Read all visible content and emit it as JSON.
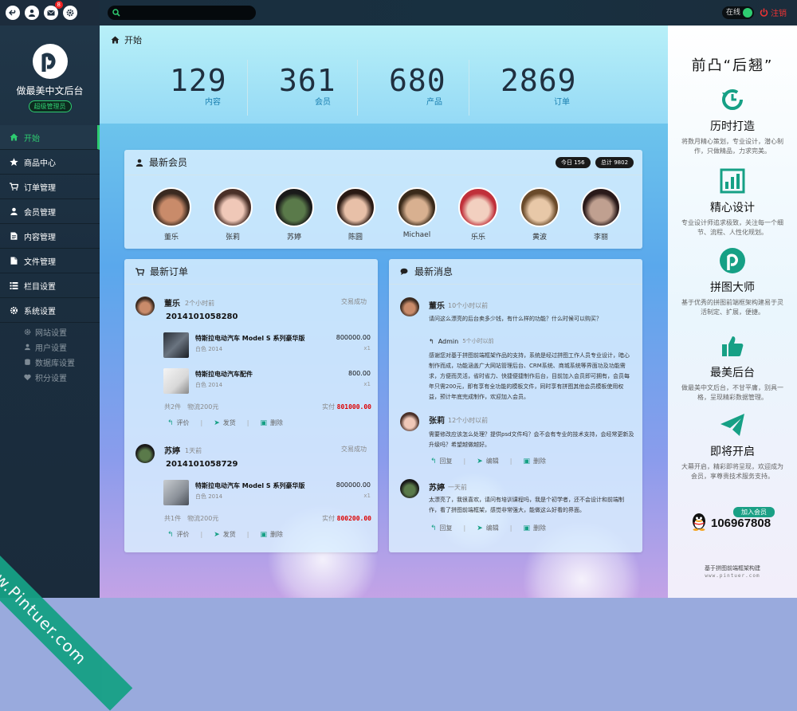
{
  "topbar": {
    "badge_count": "8",
    "online_label": "在线",
    "logout_label": "注销",
    "search": {
      "placeholder": "",
      "value": ""
    }
  },
  "sidebar": {
    "brand_title": "做最美中文后台",
    "brand_role": "超级管理员",
    "items": [
      {
        "label": "开始",
        "icon": "home-icon"
      },
      {
        "label": "商品中心",
        "icon": "star-icon"
      },
      {
        "label": "订单管理",
        "icon": "cart-icon"
      },
      {
        "label": "会员管理",
        "icon": "user-icon"
      },
      {
        "label": "内容管理",
        "icon": "file-text-icon"
      },
      {
        "label": "文件管理",
        "icon": "file-icon"
      },
      {
        "label": "栏目设置",
        "icon": "list-icon"
      },
      {
        "label": "系统设置",
        "icon": "gear-icon"
      }
    ],
    "sub_items": [
      {
        "label": "网站设置",
        "icon": "gear-icon"
      },
      {
        "label": "用户设置",
        "icon": "user-icon"
      },
      {
        "label": "数据库设置",
        "icon": "database-icon"
      },
      {
        "label": "积分设置",
        "icon": "heart-icon"
      }
    ]
  },
  "watermark": "www.Pintuer.com",
  "breadcrumb": "开始",
  "stats": [
    {
      "value": "129",
      "label": "内容"
    },
    {
      "value": "361",
      "label": "会员"
    },
    {
      "value": "680",
      "label": "产品"
    },
    {
      "value": "2869",
      "label": "订单"
    }
  ],
  "members": {
    "title": "最新会员",
    "today": "今日 156",
    "total": "总计 9802",
    "list": [
      "董乐",
      "张莉",
      "苏婷",
      "陈圆",
      "Michael",
      "乐乐",
      "黄波",
      "李丽"
    ]
  },
  "orders": {
    "title": "最新订单",
    "list": [
      {
        "user": "董乐",
        "time": "2个小时前",
        "status": "交易成功",
        "number": "2014101058280",
        "products": [
          {
            "name": "特斯拉电动汽车 Model S 系列豪华版",
            "color": "白色 2014",
            "price": "800000.00",
            "qty": "x1"
          },
          {
            "name": "特斯拉电动汽车配件",
            "color": "白色 2014",
            "price": "800.00",
            "qty": "x1"
          }
        ],
        "summary": "共2件　物流200元",
        "real_label": "实付",
        "real_value": "801000.00",
        "actions": [
          "评价",
          "发货",
          "删除"
        ]
      },
      {
        "user": "苏婷",
        "time": "1天前",
        "status": "交易成功",
        "number": "2014101058729",
        "products": [
          {
            "name": "特斯拉电动汽车 Model S 系列豪华版",
            "color": "白色 2014",
            "price": "800000.00",
            "qty": "x1"
          }
        ],
        "summary": "共1件　物流200元",
        "real_label": "实付",
        "real_value": "800200.00",
        "actions": [
          "评价",
          "发货",
          "删除"
        ]
      }
    ]
  },
  "messages": {
    "title": "最新消息",
    "list": [
      {
        "user": "董乐",
        "time": "10个小时以前",
        "text": "请问这么漂亮的后台卖多少钱，有什么样的功能？什么时候可以购买？",
        "reply_user": "Admin",
        "reply_time": "5个小时以前",
        "reply_text": "感谢您对基于拼图前端框架作品的支持，系统是经过拼图工作人员专业设计，暗心制作而成，功能涵盖广大网站管理后台、CRM系统、商城系统等界面功及功能需求，方便而灵活，省时省力、快捷便捷制作后台，目前加入会员即可拥有，会员每年只需200元，即有享有全功能的模板文件，同时享有拼图其他会员模板使用权益，预计年底完成制作，欢迎加入会员。"
      },
      {
        "user": "张莉",
        "time": "12个小时以前",
        "text": "需要修改应该怎么处理？提供psd文件吗？会不会有专业的技术支持，会经常更新及升级吗？希望越做越好。",
        "actions": [
          "回复",
          "编辑",
          "删除"
        ]
      },
      {
        "user": "苏婷",
        "time": "一天前",
        "text": "太漂亮了，我很喜欢，请问有培训课程吗，我是个初学者，还不会设计和前端制作，看了拼图前端框架，感觉非常强大，能做这么好看的界面。",
        "actions": [
          "回复",
          "编辑",
          "删除"
        ]
      }
    ]
  },
  "right": {
    "title": "前凸“后翘”",
    "features": [
      {
        "title": "历时打造",
        "desc": "将数月精心策划，专业设计，潜心制作，只做精品，力求完美。",
        "icon": "history-icon"
      },
      {
        "title": "精心设计",
        "desc": "专业设计师追求极致，关注每一个细节、流程、人性化规划。",
        "icon": "bar-chart-icon"
      },
      {
        "title": "拼图大师",
        "desc": "基于优秀的拼图前端框架构建易于灵活制定、扩展，便捷。",
        "icon": "pintuer-logo-icon"
      },
      {
        "title": "最美后台",
        "desc": "做最美中文后台，不甘平庸，别具一格，呈现精彩数据管理。",
        "icon": "thumbs-up-icon"
      },
      {
        "title": "即将开启",
        "desc": "大幕开启，精彩即将呈现，欢迎成为会员，享尊贵技术服务支持。",
        "icon": "paper-plane-icon"
      }
    ],
    "join_label": "加入会员",
    "qq": "106967808",
    "footer": "基于拼图前端框架构建",
    "footer_url": "www.pintuer.com"
  }
}
